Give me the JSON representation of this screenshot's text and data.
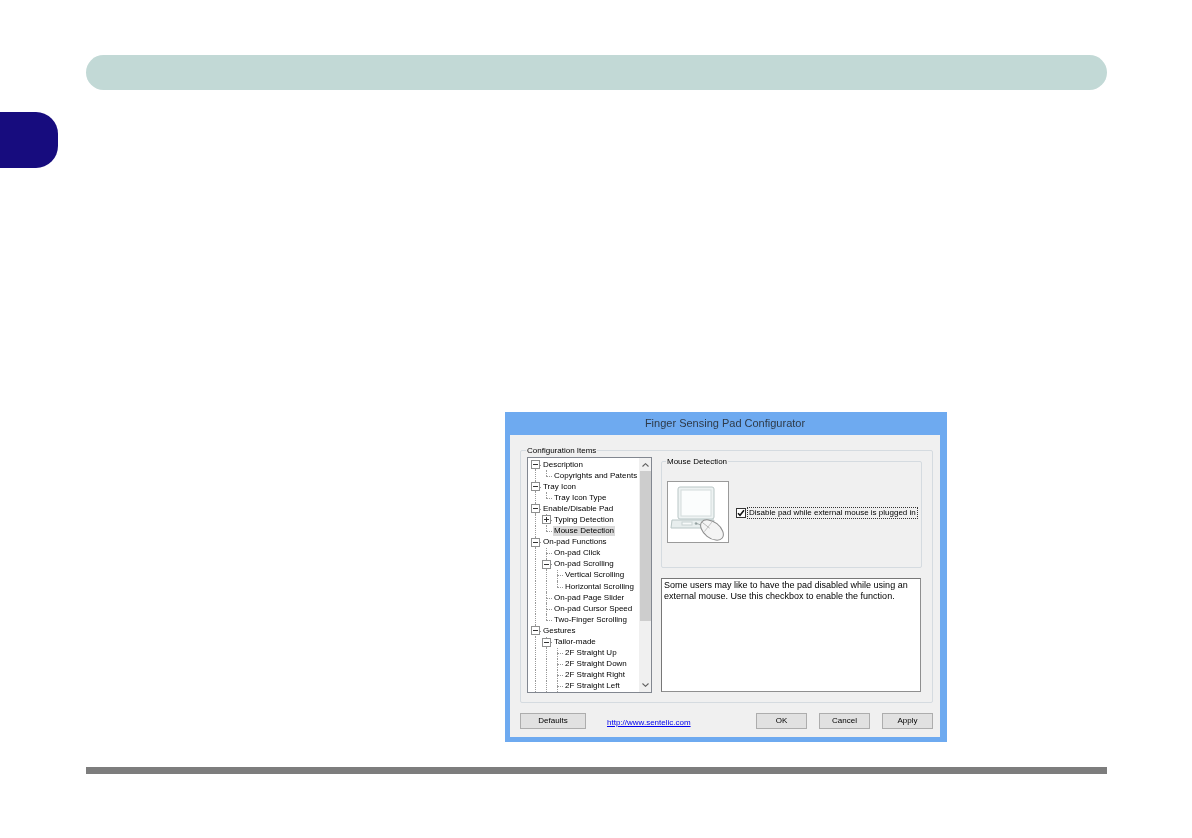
{
  "dialog": {
    "title": "Finger Sensing Pad Configurator",
    "config_group": {
      "label": "Configuration Items",
      "tree": {
        "items": [
          {
            "label": "Description",
            "expanded": true,
            "selected": false,
            "children": [
              {
                "label": "Copyrights and Patents",
                "selected": false
              }
            ]
          },
          {
            "label": "Tray Icon",
            "expanded": true,
            "selected": false,
            "children": [
              {
                "label": "Tray Icon Type",
                "selected": false
              }
            ]
          },
          {
            "label": "Enable/Disable Pad",
            "expanded": true,
            "selected": false,
            "children": [
              {
                "label": "Typing Detection",
                "expanded": false,
                "selected": false
              },
              {
                "label": "Mouse Detection",
                "selected": true
              }
            ]
          },
          {
            "label": "On-pad Functions",
            "expanded": true,
            "selected": false,
            "children": [
              {
                "label": "On-pad Click",
                "selected": false
              },
              {
                "label": "On-pad Scrolling",
                "expanded": true,
                "selected": false,
                "children": [
                  {
                    "label": "Vertical Scrolling",
                    "selected": false
                  },
                  {
                    "label": "Horizontal Scrolling",
                    "selected": false
                  }
                ]
              },
              {
                "label": "On-pad Page Slider",
                "selected": false
              },
              {
                "label": "On-pad Cursor Speed",
                "selected": false
              },
              {
                "label": "Two-Finger Scrolling",
                "selected": false
              }
            ]
          },
          {
            "label": "Gestures",
            "expanded": true,
            "selected": false,
            "children": [
              {
                "label": "Tailor-made",
                "expanded": true,
                "selected": false,
                "children": [
                  {
                    "label": "2F Straight Up",
                    "selected": false
                  },
                  {
                    "label": "2F Straight Down",
                    "selected": false
                  },
                  {
                    "label": "2F Straight Right",
                    "selected": false
                  },
                  {
                    "label": "2F Straight Left",
                    "selected": false
                  }
                ]
              }
            ]
          }
        ]
      },
      "detail_group": {
        "label": "Mouse Detection",
        "checkbox": {
          "label": "Disable pad while external mouse is plugged in",
          "checked": true,
          "focused": true
        }
      },
      "description": "Some users may like to have the pad disabled while using an external mouse. Use this checkbox to enable the function."
    },
    "footer": {
      "defaults_button": "Defaults",
      "link": "http://www.sentelic.com",
      "buttons": [
        {
          "label": "OK"
        },
        {
          "label": "Cancel"
        },
        {
          "label": "Apply"
        }
      ]
    }
  }
}
